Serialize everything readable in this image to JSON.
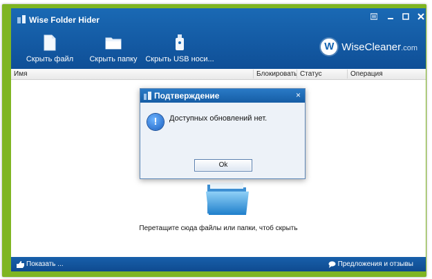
{
  "app": {
    "title": "Wise Folder Hider",
    "window_controls": [
      "menu-icon",
      "minimize-icon",
      "maximize-icon",
      "close-icon"
    ]
  },
  "toolbar": {
    "hide_file": "Скрыть файл",
    "hide_folder": "Скрыть папку",
    "hide_usb": "Скрыть USB носи..."
  },
  "brand": {
    "badge": "W",
    "name": "WiseCleaner",
    "domain": ".com"
  },
  "columns": {
    "name": "Имя",
    "lock": "Блокировать",
    "status": "Статус",
    "operation": "Операция"
  },
  "content": {
    "hint": "Перетащите сюда файлы или папки, чтоб скрыть"
  },
  "statusbar": {
    "show": "Показать ...",
    "feedback": "Предложения и отзывы"
  },
  "dialog": {
    "title": "Подтверждение",
    "message": "Доступных обновлений нет.",
    "ok": "Ok",
    "close_symbol": "×",
    "info_symbol": "!"
  },
  "colors": {
    "accent": "#0f4f97",
    "frame": "#7fb522",
    "dialog_bg": "#edf2f8"
  }
}
